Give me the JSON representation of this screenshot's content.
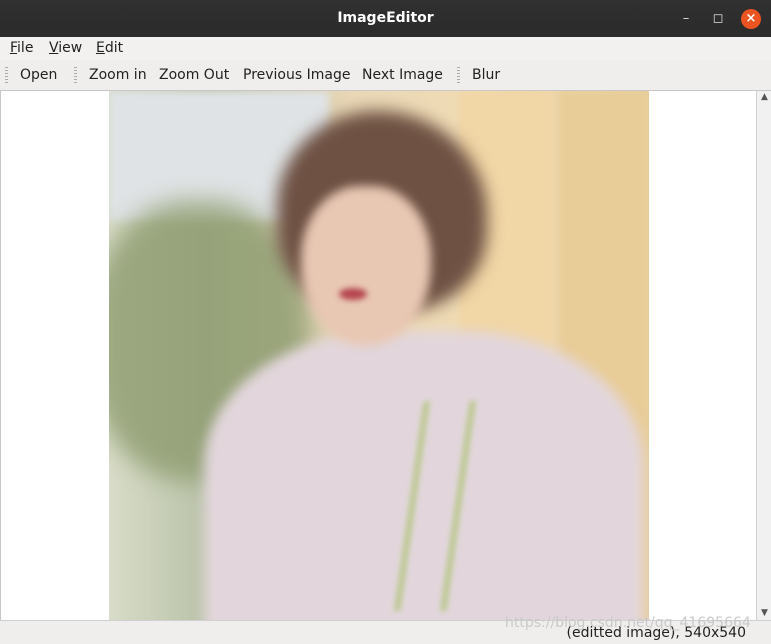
{
  "window": {
    "title": "ImageEditor",
    "minimize_icon": "minimize-icon",
    "maximize_icon": "maximize-icon",
    "close_icon": "close-icon"
  },
  "menu": {
    "file": {
      "mnemonic": "F",
      "rest": "ile"
    },
    "view": {
      "mnemonic": "V",
      "rest": "iew"
    },
    "edit": {
      "mnemonic": "E",
      "rest": "dit"
    }
  },
  "toolbar": {
    "open": "Open",
    "zoom_in": "Zoom in",
    "zoom_out": "Zoom Out",
    "previous_image": "Previous Image",
    "next_image": "Next Image",
    "blur": "Blur"
  },
  "image": {
    "description_icon": "photo-canvas",
    "effect": "blurred"
  },
  "scrollbar": {
    "up_icon": "arrow-up-icon",
    "down_icon": "arrow-down-icon"
  },
  "status": {
    "text": "(editted image), 540x540"
  },
  "watermark": {
    "text": "https://blog.csdn.net/qq_41695664"
  },
  "colors": {
    "titlebar": "#2b2b2b",
    "close_button": "#e95420",
    "viewport_bg": "#ffffff"
  }
}
